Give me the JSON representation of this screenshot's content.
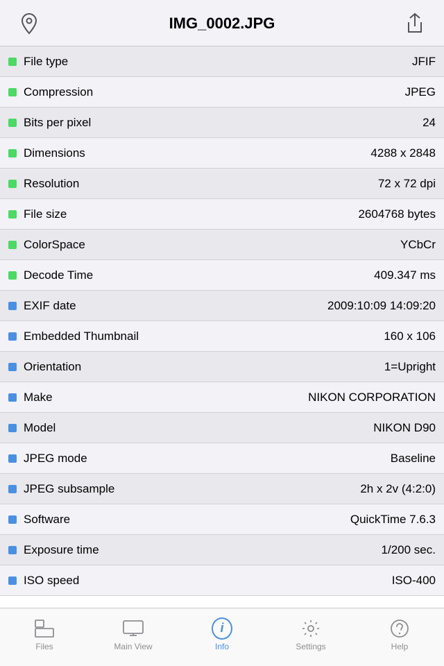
{
  "header": {
    "title": "IMG_0002.JPG"
  },
  "rows": [
    {
      "id": "file-type",
      "indicator": "green",
      "label": "File type",
      "value": "JFIF"
    },
    {
      "id": "compression",
      "indicator": "green",
      "label": "Compression",
      "value": "JPEG"
    },
    {
      "id": "bits-per-pixel",
      "indicator": "green",
      "label": "Bits per pixel",
      "value": "24"
    },
    {
      "id": "dimensions",
      "indicator": "green",
      "label": "Dimensions",
      "value": "4288 x 2848"
    },
    {
      "id": "resolution",
      "indicator": "green",
      "label": "Resolution",
      "value": "72 x 72 dpi"
    },
    {
      "id": "file-size",
      "indicator": "green",
      "label": "File size",
      "value": "2604768 bytes"
    },
    {
      "id": "colorspace",
      "indicator": "green",
      "label": "ColorSpace",
      "value": "YCbCr"
    },
    {
      "id": "decode-time",
      "indicator": "green",
      "label": "Decode Time",
      "value": "409.347 ms"
    },
    {
      "id": "exif-date",
      "indicator": "blue",
      "label": "EXIF date",
      "value": "2009:10:09 14:09:20"
    },
    {
      "id": "embedded-thumbnail",
      "indicator": "blue",
      "label": "Embedded Thumbnail",
      "value": "160 x 106"
    },
    {
      "id": "orientation",
      "indicator": "blue",
      "label": "Orientation",
      "value": "1=Upright"
    },
    {
      "id": "make",
      "indicator": "blue",
      "label": "Make",
      "value": "NIKON CORPORATION"
    },
    {
      "id": "model",
      "indicator": "blue",
      "label": "Model",
      "value": "NIKON D90"
    },
    {
      "id": "jpeg-mode",
      "indicator": "blue",
      "label": "JPEG mode",
      "value": "Baseline"
    },
    {
      "id": "jpeg-subsample",
      "indicator": "blue",
      "label": "JPEG subsample",
      "value": "2h x 2v (4:2:0)"
    },
    {
      "id": "software",
      "indicator": "blue",
      "label": "Software",
      "value": "QuickTime 7.6.3"
    },
    {
      "id": "exposure-time",
      "indicator": "blue",
      "label": "Exposure time",
      "value": "1/200 sec."
    },
    {
      "id": "iso-speed",
      "indicator": "blue",
      "label": "ISO speed",
      "value": "ISO-400"
    }
  ],
  "tabs": [
    {
      "id": "files",
      "label": "Files",
      "active": false
    },
    {
      "id": "main-view",
      "label": "Main View",
      "active": false
    },
    {
      "id": "info",
      "label": "Info",
      "active": true
    },
    {
      "id": "settings",
      "label": "Settings",
      "active": false
    },
    {
      "id": "help",
      "label": "Help",
      "active": false
    }
  ]
}
